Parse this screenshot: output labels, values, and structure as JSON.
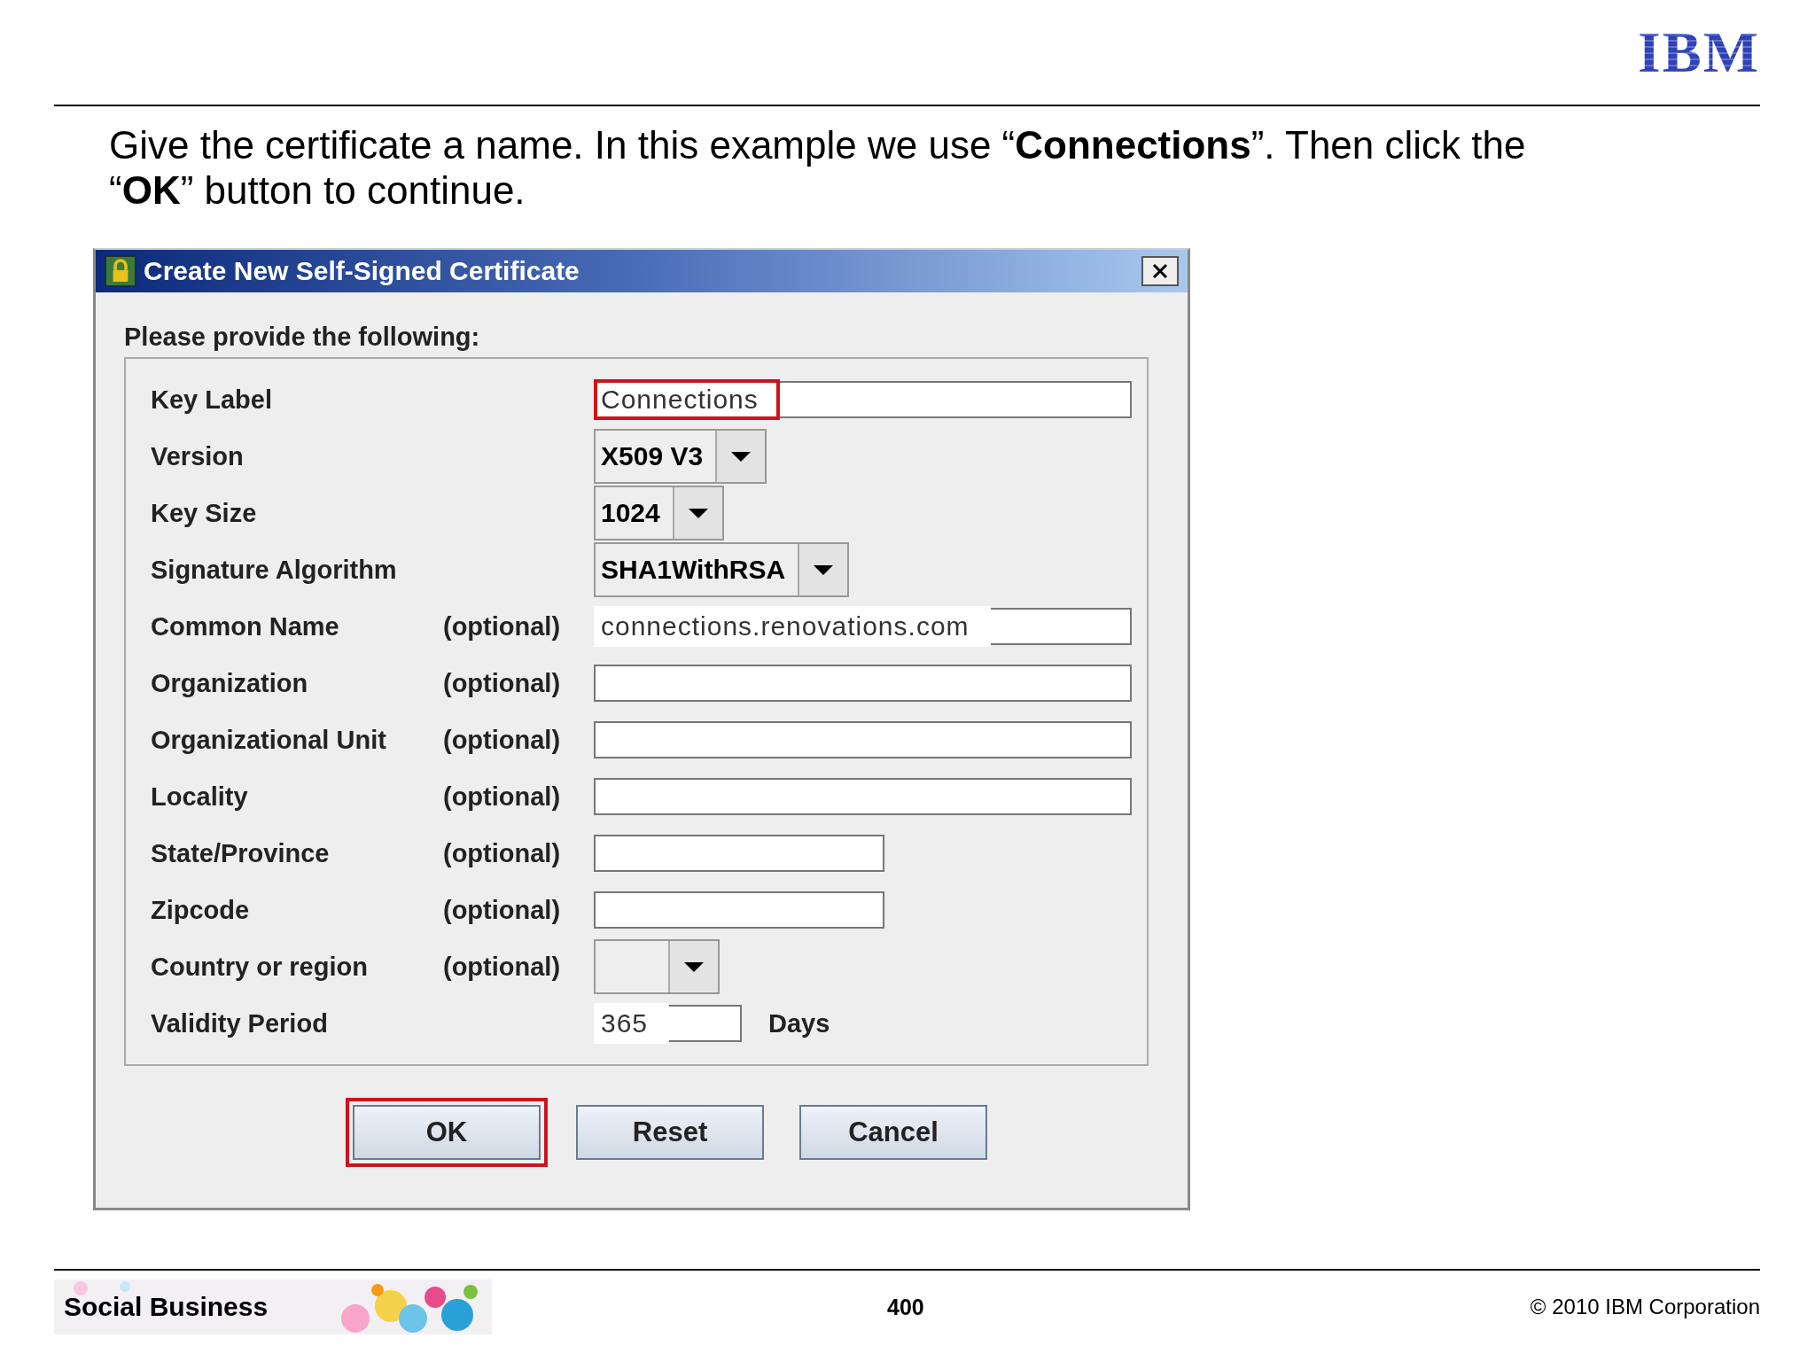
{
  "header": {
    "logo": "IBM"
  },
  "instruction": "Give the certificate a name. In this example we use “**Connections**”. Then click the “**OK**” button to continue.",
  "dialog": {
    "title": "Create New Self-Signed Certificate",
    "prompt": "Please provide the following:",
    "fields": [
      {
        "label": "Key Label",
        "kind": "text",
        "value": "Connections",
        "highlighted": true
      },
      {
        "label": "Version",
        "kind": "select",
        "value": "X509 V3"
      },
      {
        "label": "Key Size",
        "kind": "select",
        "value": "1024"
      },
      {
        "label": "Signature Algorithm",
        "kind": "select",
        "value": "SHA1WithRSA"
      },
      {
        "label": "Common Name",
        "note": "(optional)",
        "kind": "text",
        "value": "connections.renovations.com"
      },
      {
        "label": "Organization",
        "note": "(optional)",
        "kind": "text"
      },
      {
        "label": "Organizational Unit",
        "note": "(optional)",
        "kind": "text"
      },
      {
        "label": "Locality",
        "note": "(optional)",
        "kind": "text"
      },
      {
        "label": "State/Province",
        "note": "(optional)",
        "kind": "short"
      },
      {
        "label": "Zipcode",
        "note": "(optional)",
        "kind": "short"
      },
      {
        "label": "Country or region",
        "note": "(optional)",
        "kind": "select"
      },
      {
        "label": "Validity Period",
        "kind": "number",
        "value": "365",
        "suffix": "Days"
      }
    ],
    "buttons": [
      {
        "label": "OK",
        "highlighted": true
      },
      {
        "label": "Reset",
        "highlighted": false
      },
      {
        "label": "Cancel",
        "highlighted": false
      }
    ]
  },
  "footer": {
    "brand": "Social Business",
    "page": "400",
    "copyright": "© 2010 IBM Corporation"
  }
}
